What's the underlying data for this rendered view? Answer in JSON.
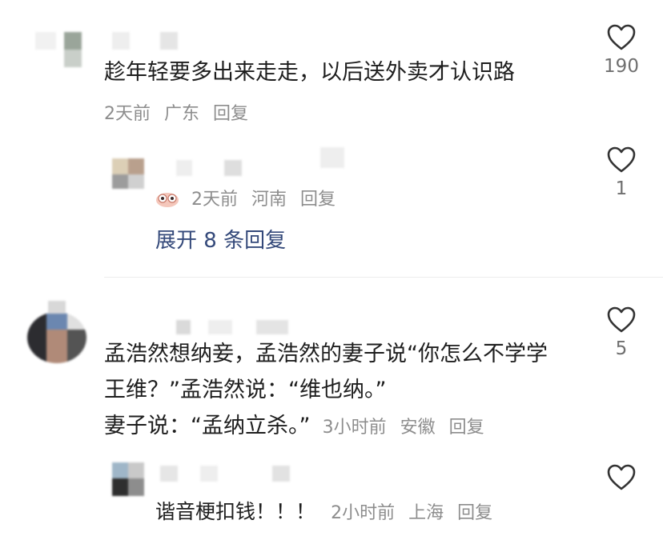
{
  "comments": [
    {
      "text": "趁年轻要多出来走走，以后送外卖才认识路",
      "time": "2天前",
      "location": "广东",
      "reply_label": "回复",
      "likes": "190",
      "replies": [
        {
          "time": "2天前",
          "location": "河南",
          "reply_label": "回复",
          "likes": "1",
          "icon": "owl-emoji-icon"
        }
      ],
      "expand_label": "展开 8 条回复"
    },
    {
      "text_lines": [
        "孟浩然想纳妾，孟浩然的妻子说“你怎么不学学",
        "王维？”孟浩然说：“维也纳。”",
        "妻子说：“孟纳立杀。”"
      ],
      "time": "3小时前",
      "location": "安徽",
      "reply_label": "回复",
      "likes": "5",
      "replies": [
        {
          "text": "谐音梗扣钱！！！",
          "time": "2小时前",
          "location": "上海",
          "reply_label": "回复",
          "likes": ""
        }
      ]
    }
  ],
  "icons": {
    "like": "heart-outline-icon"
  },
  "colors": {
    "text": "#1e1e1e",
    "meta": "#8d8d8d",
    "link": "#34497a",
    "heart_stroke": "#333333"
  }
}
